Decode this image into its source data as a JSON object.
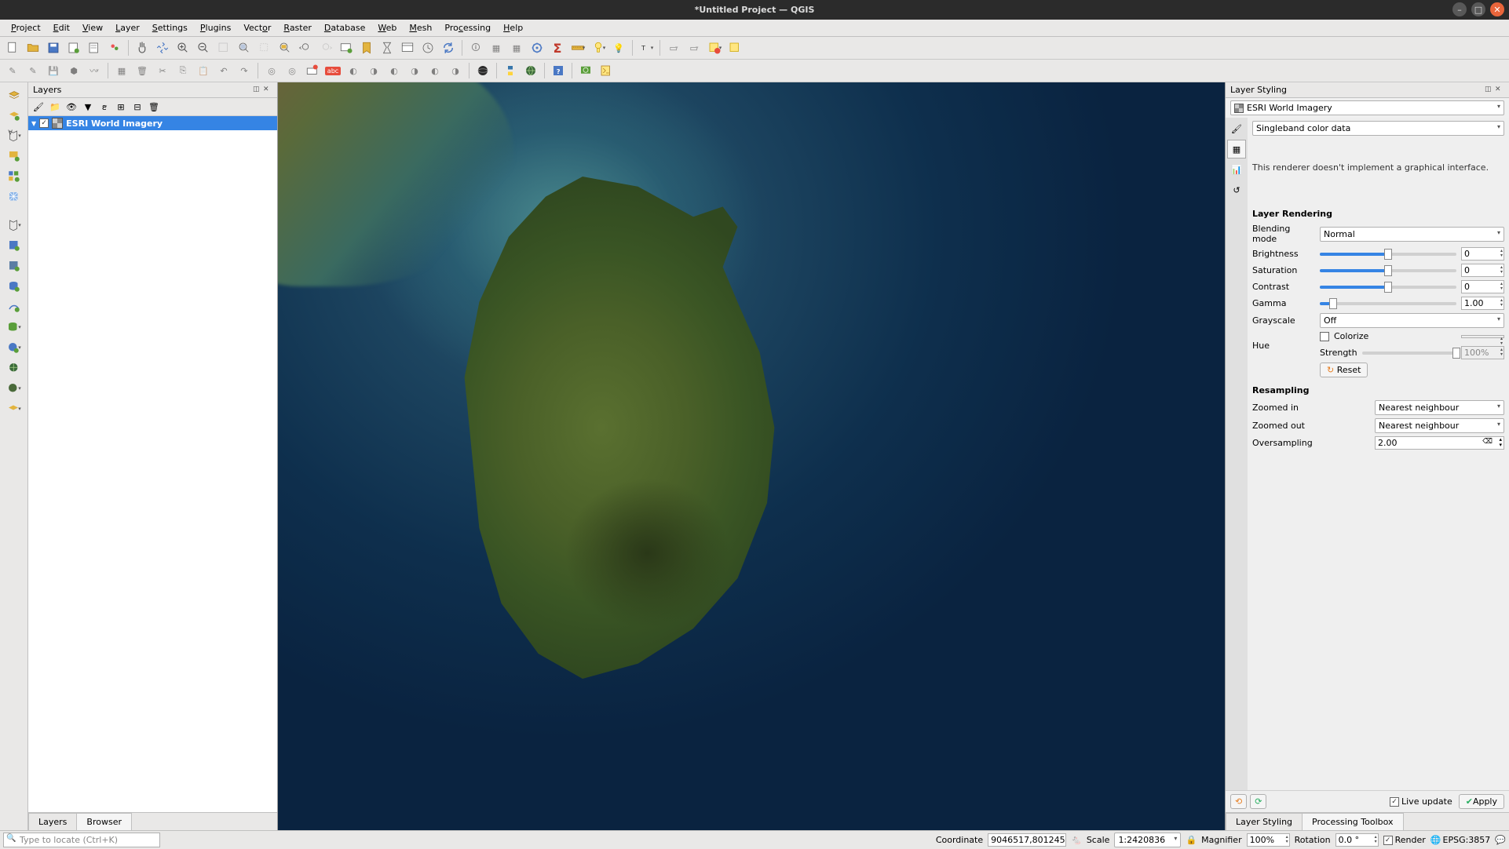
{
  "window": {
    "title": "*Untitled Project — QGIS"
  },
  "menu": [
    "Project",
    "Edit",
    "View",
    "Layer",
    "Settings",
    "Plugins",
    "Vector",
    "Raster",
    "Database",
    "Web",
    "Mesh",
    "Processing",
    "Help"
  ],
  "layers_panel": {
    "title": "Layers",
    "items": [
      {
        "checked": true,
        "label": "ESRI World Imagery"
      }
    ],
    "tabs": {
      "layers": "Layers",
      "browser": "Browser"
    }
  },
  "styling": {
    "title": "Layer Styling",
    "layer": "ESRI World Imagery",
    "renderer": "Singleband color data",
    "renderer_msg": "This renderer doesn't implement a graphical interface.",
    "section_rendering": "Layer Rendering",
    "blending_label": "Blending mode",
    "blending": "Normal",
    "brightness_label": "Brightness",
    "brightness": "0",
    "saturation_label": "Saturation",
    "saturation": "0",
    "contrast_label": "Contrast",
    "contrast": "0",
    "gamma_label": "Gamma",
    "gamma": "1.00",
    "grayscale_label": "Grayscale",
    "grayscale": "Off",
    "hue_label": "Hue",
    "colorize_label": "Colorize",
    "strength_label": "Strength",
    "strength": "100%",
    "reset": "Reset",
    "section_resampling": "Resampling",
    "zoomed_in_label": "Zoomed in",
    "zoomed_in": "Nearest neighbour",
    "zoomed_out_label": "Zoomed out",
    "zoomed_out": "Nearest neighbour",
    "oversampling_label": "Oversampling",
    "oversampling": "2.00",
    "live_update": "Live update",
    "apply": "Apply",
    "tabs": {
      "styling": "Layer Styling",
      "toolbox": "Processing Toolbox"
    }
  },
  "status": {
    "locator_placeholder": "Type to locate (Ctrl+K)",
    "coord_label": "Coordinate",
    "coord": "9046517,801245",
    "scale_label": "Scale",
    "scale": "1:2420836",
    "magnifier_label": "Magnifier",
    "magnifier": "100%",
    "rotation_label": "Rotation",
    "rotation": "0.0 °",
    "render": "Render",
    "epsg": "EPSG:3857"
  }
}
